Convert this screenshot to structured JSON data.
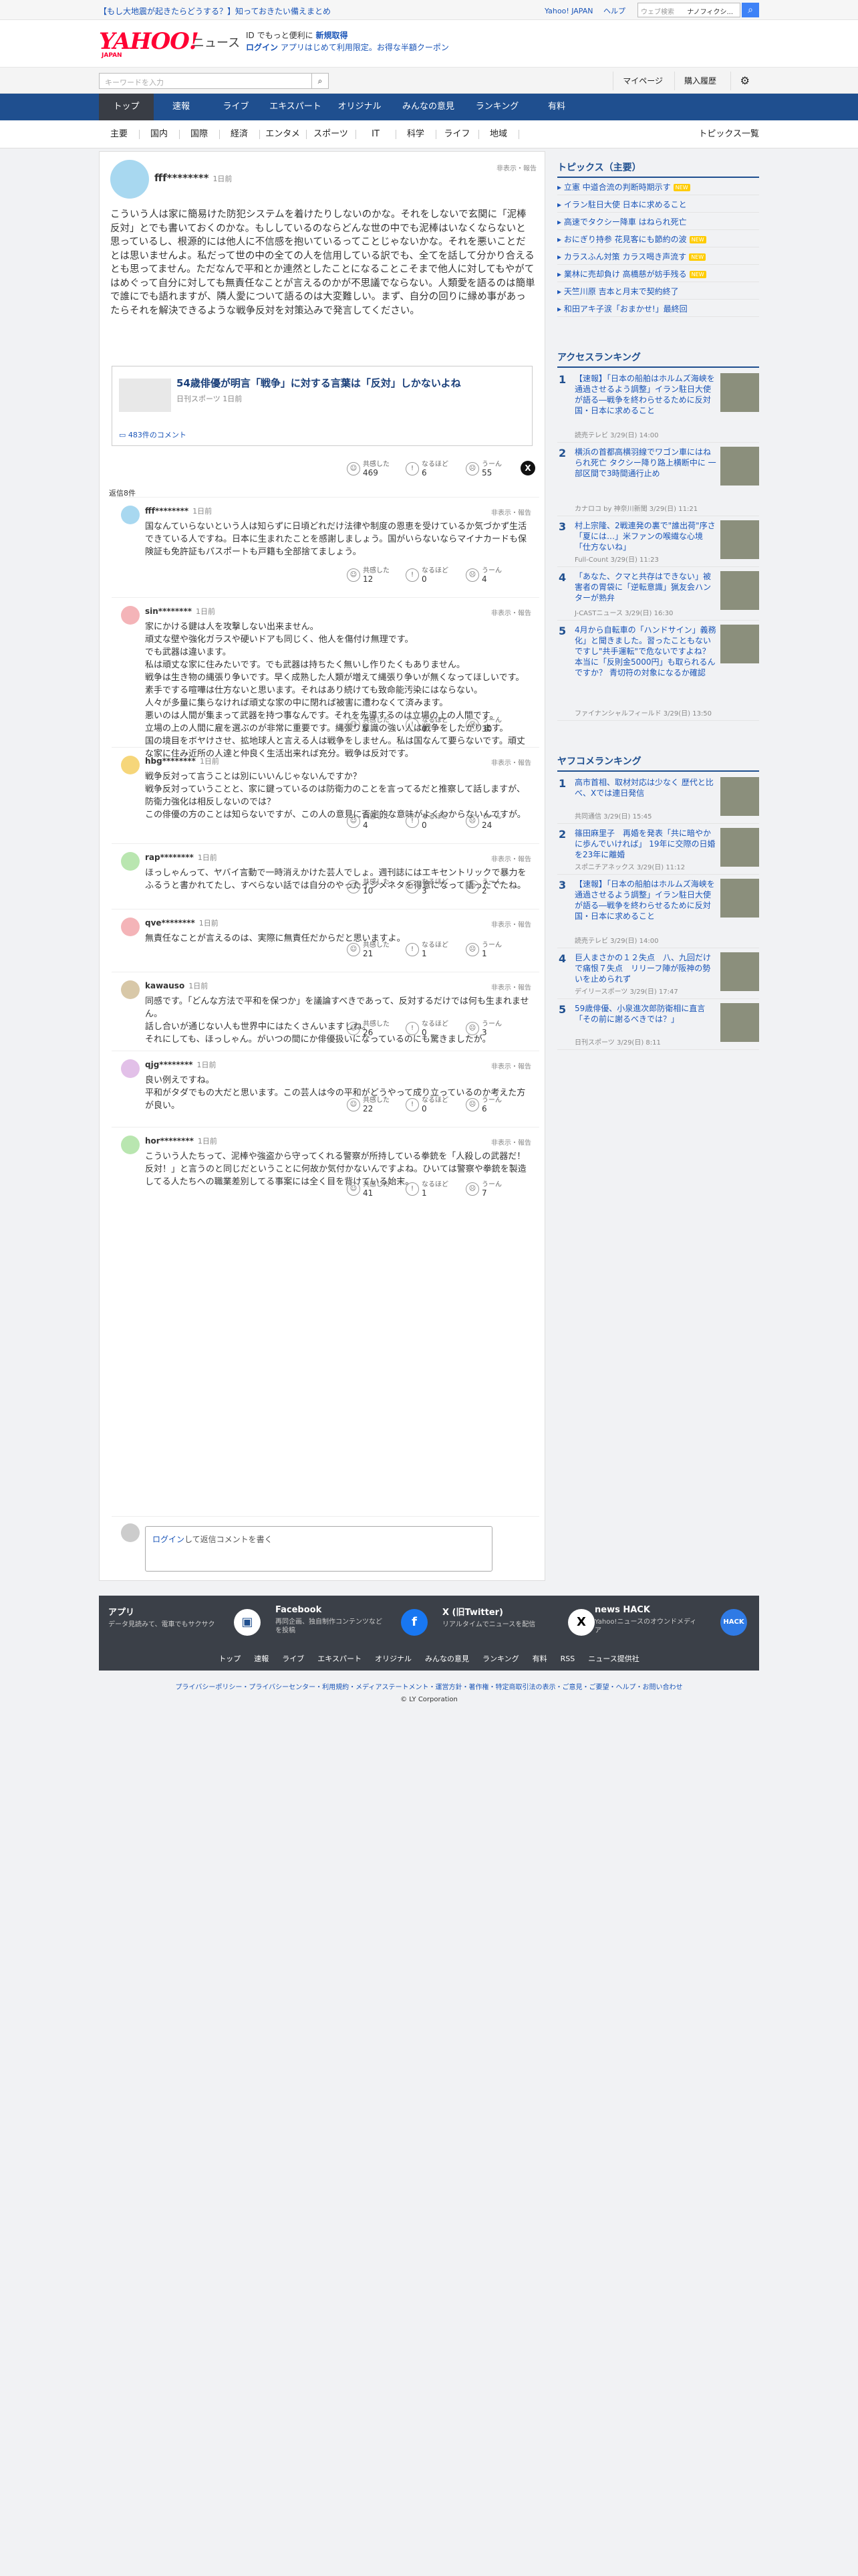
{
  "topbar": {
    "notice": "【もし大地震が起きたらどうする？】知っておきたい備えまとめ",
    "japan": "Yahoo! JAPAN",
    "help": "ヘルプ",
    "search_placeholder": "ウェブ検索",
    "search_value": "ナノフィクシ..."
  },
  "brand": {
    "logo": "YAHOO!",
    "logo_sub": "JAPAN",
    "news": "ニュース",
    "promo1": "ID でもっと便利に",
    "promo1_link": "新規取得",
    "promo2a": "ログイン",
    "promo2b": "アプリはじめて利用限定。お得な半額クーポン"
  },
  "search": {
    "placeholder": "キーワードを入力",
    "mypage": "マイページ",
    "history": "購入履歴"
  },
  "gnav": [
    "トップ",
    "速報",
    "ライブ",
    "エキスパート",
    "オリジナル",
    "みんなの意見",
    "ランキング",
    "有料"
  ],
  "subnav": [
    "主要",
    "国内",
    "国際",
    "経済",
    "エンタメ",
    "スポーツ",
    "IT",
    "科学",
    "ライフ",
    "地域"
  ],
  "subnav_all": "トピックス一覧",
  "post": {
    "user": "fff********",
    "time": "1日前",
    "report": "非表示・報告",
    "body": "こういう人は家に簡易けた防犯システムを着けたりしないのかな。それをしないで玄関に「泥棒反対」とでも書いておくのかな。もししているのならどんな世の中でも泥棒はいなくならないと思っているし、根源的には他人に不信感を抱いているってことじゃないかな。それを悪いことだとは思いませんよ。私だって世の中の全ての人を信用している訳でも、全てを話して分かり合えるとも思ってません。ただなんで平和とか連然としたことになることこそまで他人に対してもやがてはめぐって自分に対しても無責任なことが言えるのかが不思議でならない。人類愛を語るのは簡単で誰にでも語れますが、隣人愛について語るのは大変難しい。まず、自分の回りに縁め事があったらそれを解決できるような戦争反対を対策込みで発言してください。",
    "article_title": "54歳俳優が明言「戦争」に対する言葉は「反対」しかないよね",
    "article_src": "日刊スポーツ 1日前",
    "comments_link": "483件のコメント",
    "r1": "共感した",
    "r1n": "469",
    "r2": "なるほど",
    "r2n": "6",
    "r3": "うーん",
    "r3n": "55",
    "replies_label": "返信8件"
  },
  "replies": [
    {
      "user": "fff********",
      "time": "1日前",
      "body": "国なんていらないという人は知らずに日頃どれだけ法律や制度の恩恵を受けているか気づかず生活できている人ですね。日本に生まれたことを感謝しましょう。国がいらないならマイナカードも保険証も免許証もパスポートも戸籍も全部捨てましょう。",
      "a": "12",
      "b": "0",
      "c": "4"
    },
    {
      "user": "sin********",
      "time": "1日前",
      "body": "家にかける鍵は人を攻撃しない出来ません。\n頑丈な壁や強化ガラスや硬いドアも同じく、他人を傷付け無理です。\nでも武器は違います。\n私は頑丈な家に住みたいです。でも武器は持ちたく無いし作りたくもありません。\n戦争は生き物の縄張り争いです。早く成熟した人類が増えて縄張り争いが無くなってほしいです。\n素手でする喧嘩は仕方ないと思います。それはあり続けても致命能汚染にはならない。\n人々が多量に集らなければ頑丈な家の中に閉れば被害に遭わなくて済みます。\n悪いのは人間が集まって武器を持つ事なんです。それを先導するのは立場の上の人間です。\n立場の上の人間に雇を選ぶのが非常に重要です。縄張り意識の強い人は戦争をしたがります。\n国の境目をボヤけさせ、拡地球人と言える人は戦争をしません。私は国なんて要らないです。頑丈な家に住み近所の人達と仲良く生活出来れば充分。戦争は反対です。",
      "a": "5",
      "b": "0",
      "c": "30"
    },
    {
      "user": "hbg********",
      "time": "1日前",
      "body": "戦争反対って言うことは別にいいんじゃないんですか？\n戦争反対っていうことと、家に鍵っているのは防衛力のことを言ってるだと推察して話しますが、防衛力強化は相反しないのでは？\nこの俳優の方のことは知らないですが、この人の意見に否定的な意味がよくわからないんですが。",
      "a": "4",
      "b": "0",
      "c": "24"
    },
    {
      "user": "rap********",
      "time": "1日前",
      "body": "ほっしゃんって、ヤバイ言動で一時消えかけた芸人でしょ。週刊誌にはエキセントリックで暴力をふるうと書かれてたし、すべらない話では自分のやったイジメネタを得意になって語ったてたね。",
      "a": "10",
      "b": "3",
      "c": "2"
    },
    {
      "user": "qve********",
      "time": "1日前",
      "body": "無責任なことが言えるのは、実際に無責任だからだと思いますよ。",
      "a": "21",
      "b": "1",
      "c": "1"
    },
    {
      "user": "kawauso",
      "time": "1日前",
      "body": "同感です。「どんな方法で平和を保つか」を議論すべきであって、反対するだけでは何も生まれません。\n話し合いが通じない人も世界中にはたくさんいますしね。\nそれにしても、ほっしゃん。がいつの間にか俳優扱いになっているのにも驚きましたが。",
      "a": "26",
      "b": "0",
      "c": "3"
    },
    {
      "user": "qjg********",
      "time": "1日前",
      "body": "良い例えですね。\n平和がタダでもの大だと思います。この芸人は今の平和がどうやって成り立っているのか考えた方が良い。",
      "a": "22",
      "b": "0",
      "c": "6"
    },
    {
      "user": "hor********",
      "time": "1日前",
      "body": "こういう人たちって、泥棒や強盗から守ってくれる警察が所持している拳銃を「人殺しの武器だ！反対！」と言うのと同じだということに何故か気付かないんですよね。ひいては警察や拳銃を製造してる人たちへの職業差別してる事案には全く目を背けている始末。",
      "a": "41",
      "b": "1",
      "c": "7"
    }
  ],
  "reactions": {
    "a": "共感した",
    "b": "なるほど",
    "c": "うーん"
  },
  "composer": {
    "login": "ログイン",
    "text": "して返信コメントを書く"
  },
  "side": {
    "topics_head": "トピックス（主要）",
    "topics": [
      {
        "t": "立憲 中道合流の判断時期示す",
        "n": true
      },
      {
        "t": "イラン駐日大使 日本に求めること",
        "n": false
      },
      {
        "t": "高速でタクシー降車 はねられ死亡",
        "n": false
      },
      {
        "t": "おにぎり持参 花見客にも節約の波",
        "n": true
      },
      {
        "t": "カラスふん対策 カラス喝き声流す",
        "n": true
      },
      {
        "t": "業林に売却負け 高橋慈が妨手残る",
        "n": true
      },
      {
        "t": "天竺川原 吉本と月末で契約終了",
        "n": false
      },
      {
        "t": "和田アキ子涙「おまかせ!」最終回",
        "n": false
      }
    ],
    "tag": "NEW",
    "access_head": "アクセスランキング",
    "access": [
      {
        "t": "【速報】「日本の船舶はホルムズ海峡を通過させるよう調整」イラン駐日大使が語る―戦争を終わらせるために反対国・日本に求めること",
        "s": "読売テレビ 3/29(日) 14:00"
      },
      {
        "t": "横浜の首都高横羽線でワゴン車にはねられ死亡 タクシー降り路上横断中に 一部区間で3時間通行止め",
        "s": "カナロコ by 神奈川新聞 3/29(日) 11:21"
      },
      {
        "t": "村上宗隆、2戦連発の裏で\"誰出荷\"序さ「夏には…」米ファンの喉繊な心境「仕方ないね」",
        "s": "Full-Count 3/29(日) 11:23"
      },
      {
        "t": "「あなた、クマと共存はできない」被害者の胃袋に「逆転意識」猟友会ハンターが熟弁",
        "s": "J-CASTニュース 3/29(日) 16:30"
      },
      {
        "t": "4月から自転車の「ハンドサイン」義務化」と聞きました。習ったこともないですし\"共手運転\"で危ないですよね？ 本当に「反則金5000円」も取られるんですか？ 青切符の対象になるか確認",
        "s": "ファイナンシャルフィールド 3/29(日) 13:50"
      }
    ],
    "yafuko_head": "ヤフコメランキング",
    "yafuko": [
      {
        "t": "高市首相、取材対応は少なく 歴代と比べ、Xでは連日発信",
        "s": "共同通信 3/29(日) 15:45"
      },
      {
        "t": "篠田麻里子　再婚を発表「共に暗やかに歩んでいければ」 19年に交際の日婚を23年に離婚",
        "s": "スポニチアネックス 3/29(日) 11:12"
      },
      {
        "t": "【速報】「日本の船舶はホルムズ海峡を通過させるよう調整」イラン駐日大使が語る―戦争を終わらせるために反対国・日本に求めること",
        "s": "読売テレビ 3/29(日) 14:00"
      },
      {
        "t": "巨人まさかの１２失点　八、九回だけで痛恨７失点　リリーフ陣が阪神の勢いを止められず",
        "s": "デイリースポーツ 3/29(日) 17:47"
      },
      {
        "t": "59歳俳優、小泉進次郎防衛相に直言「その前に謝るべきでは？」",
        "s": "日刊スポーツ 3/29(日) 8:11"
      }
    ]
  },
  "footer": {
    "cols": [
      {
        "h": "アプリ",
        "d": "データ見読みて、電車でもサクサク"
      },
      {
        "h": "Facebook",
        "d": "再同企画、独自制作コンテンツなどを投稿"
      },
      {
        "h": "X (旧Twitter)",
        "d": "リアルタイムでニュースを配信"
      },
      {
        "h": "news HACK",
        "d": "Yahoo!ニュースのオウンドメディア"
      }
    ],
    "links": [
      "トップ",
      "速報",
      "ライブ",
      "エキスパート",
      "オリジナル",
      "みんなの意見",
      "ランキング",
      "有料",
      "RSS",
      "ニュース提供社"
    ],
    "legal": "プライバシーポリシー・プライバシーセンター・利用規約・メディアステートメント・運営方針・著作権・特定商取引法の表示・ご意見・ご要望・ヘルプ・お問い合わせ",
    "copyright": "© LY Corporation"
  }
}
